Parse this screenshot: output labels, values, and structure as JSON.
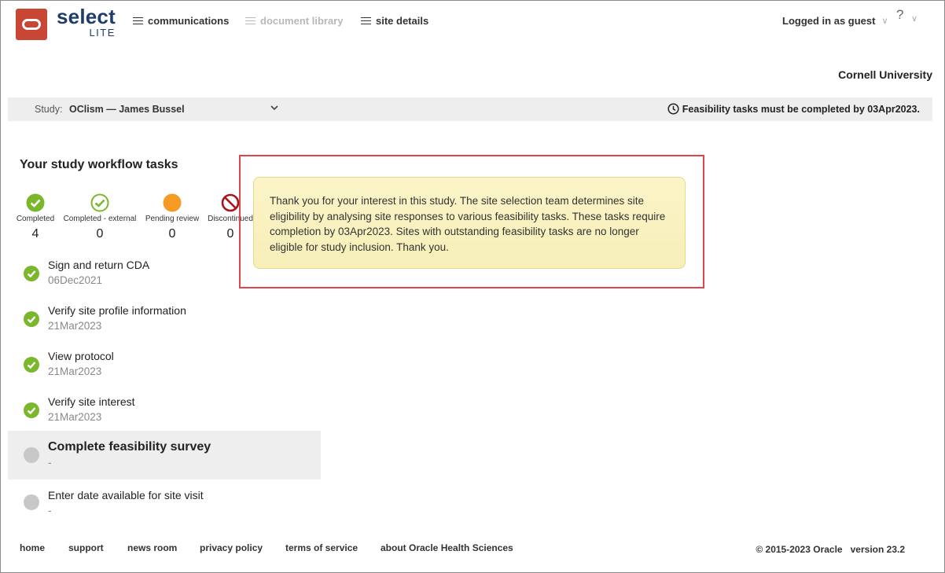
{
  "brand": {
    "name": "select",
    "edition": "LITE",
    "logo_color": "#c74634",
    "text_color": "#1f3d6b"
  },
  "nav": [
    {
      "label": "communications",
      "icon": "list-icon",
      "enabled": true
    },
    {
      "label": "document library",
      "icon": "list-icon",
      "enabled": false
    },
    {
      "label": "site details",
      "icon": "list-icon",
      "enabled": true
    }
  ],
  "user": {
    "label": "Logged in as guest",
    "help": "?"
  },
  "institution": "Cornell University",
  "study": {
    "label": "Study:",
    "value": "OClism — James Bussel"
  },
  "deadline": "Feasibility tasks must be completed by 03Apr2023.",
  "tasks_section": {
    "title": "Your study workflow tasks",
    "stats": [
      {
        "label": "Completed",
        "count": "4",
        "icon": "check-filled-icon",
        "color": "#7bb72c"
      },
      {
        "label": "Completed - external",
        "count": "0",
        "icon": "check-outline-icon",
        "color": "#7bb72c"
      },
      {
        "label": "Pending review",
        "count": "0",
        "icon": "pending-dot-icon",
        "color": "#f59a23"
      },
      {
        "label": "Discontinued",
        "count": "0",
        "icon": "prohibited-icon",
        "color": "#a8161b"
      }
    ],
    "tasks": [
      {
        "name": "Sign and return CDA",
        "date": "06Dec2021",
        "status": "completed"
      },
      {
        "name": "Verify site profile information",
        "date": "21Mar2023",
        "status": "completed"
      },
      {
        "name": "View protocol",
        "date": "21Mar2023",
        "status": "completed"
      },
      {
        "name": "Verify site interest",
        "date": "21Mar2023",
        "status": "completed"
      },
      {
        "name": "Complete feasibility survey",
        "date": "-",
        "status": "not-started"
      },
      {
        "name": "Enter date available for site visit",
        "date": "-",
        "status": "not-started"
      }
    ]
  },
  "message": "Thank you for your interest in this study. The site selection team determines site eligibility by analysing site responses to various feasibility tasks. These tasks require completion by 03Apr2023. Sites with outstanding feasibility tasks are no longer eligible for study inclusion. Thank you.",
  "footer": {
    "links": [
      "home",
      "support",
      "news room",
      "privacy policy",
      "terms of service",
      "about Oracle Health Sciences"
    ],
    "copyright": "© 2015-2023 Oracle",
    "version": "version 23.2"
  }
}
